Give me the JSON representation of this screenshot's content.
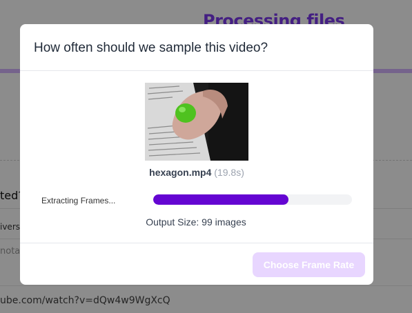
{
  "background": {
    "page_title": "Processing files",
    "question_fragment": "ted?",
    "row_text_1": "ivers",
    "row_text_2": "nota",
    "url_fragment": "ube.com/watch?v=dQw4w9WgXcQ"
  },
  "modal": {
    "title": "How often should we sample this video?",
    "file": {
      "name": "hexagon.mp4",
      "duration": "(19.8s)"
    },
    "progress": {
      "label": "Extracting Frames...",
      "fraction": 0.68
    },
    "output_size": "Output Size: 99 images",
    "choose_button_label": "Choose Frame Rate"
  },
  "colors": {
    "accent": "#6405d2",
    "button_disabled": "#e8d6ff",
    "title_purple": "#7c3aed"
  }
}
